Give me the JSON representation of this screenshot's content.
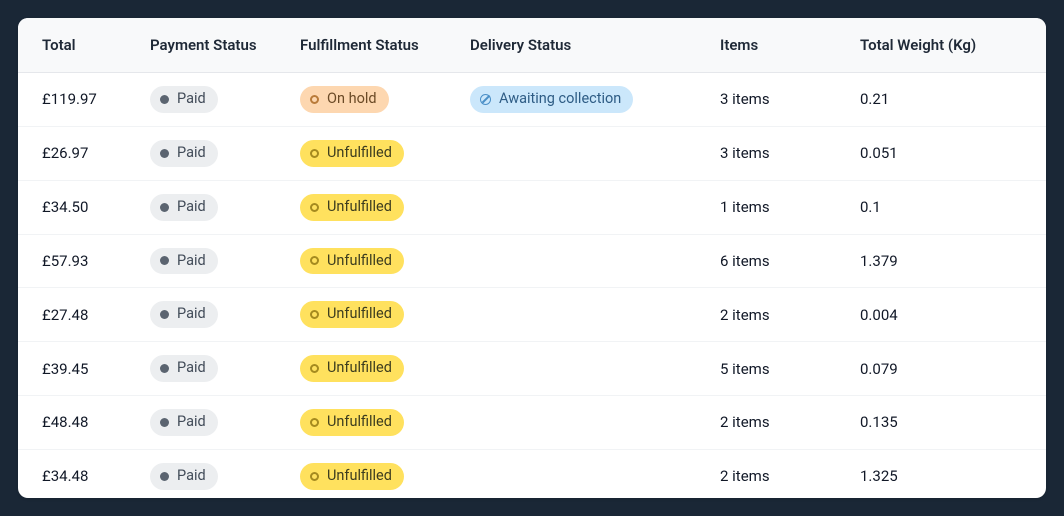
{
  "columns": {
    "total": "Total",
    "payment": "Payment Status",
    "fulfillment": "Fulfillment Status",
    "delivery": "Delivery Status",
    "items": "Items",
    "weight": "Total Weight (Kg)"
  },
  "rows": [
    {
      "total": "£119.97",
      "payment": "Paid",
      "fulfillment": "On hold",
      "fulfillment_style": "orange",
      "delivery": "Awaiting collection",
      "items": "3 items",
      "weight": "0.21"
    },
    {
      "total": "£26.97",
      "payment": "Paid",
      "fulfillment": "Unfulfilled",
      "fulfillment_style": "yellow",
      "delivery": "",
      "items": "3 items",
      "weight": "0.051"
    },
    {
      "total": "£34.50",
      "payment": "Paid",
      "fulfillment": "Unfulfilled",
      "fulfillment_style": "yellow",
      "delivery": "",
      "items": "1 items",
      "weight": "0.1"
    },
    {
      "total": "£57.93",
      "payment": "Paid",
      "fulfillment": "Unfulfilled",
      "fulfillment_style": "yellow",
      "delivery": "",
      "items": "6 items",
      "weight": "1.379"
    },
    {
      "total": "£27.48",
      "payment": "Paid",
      "fulfillment": "Unfulfilled",
      "fulfillment_style": "yellow",
      "delivery": "",
      "items": "2 items",
      "weight": "0.004"
    },
    {
      "total": "£39.45",
      "payment": "Paid",
      "fulfillment": "Unfulfilled",
      "fulfillment_style": "yellow",
      "delivery": "",
      "items": "5 items",
      "weight": "0.079"
    },
    {
      "total": "£48.48",
      "payment": "Paid",
      "fulfillment": "Unfulfilled",
      "fulfillment_style": "yellow",
      "delivery": "",
      "items": "2 items",
      "weight": "0.135"
    },
    {
      "total": "£34.48",
      "payment": "Paid",
      "fulfillment": "Unfulfilled",
      "fulfillment_style": "yellow",
      "delivery": "",
      "items": "2 items",
      "weight": "1.325"
    }
  ]
}
